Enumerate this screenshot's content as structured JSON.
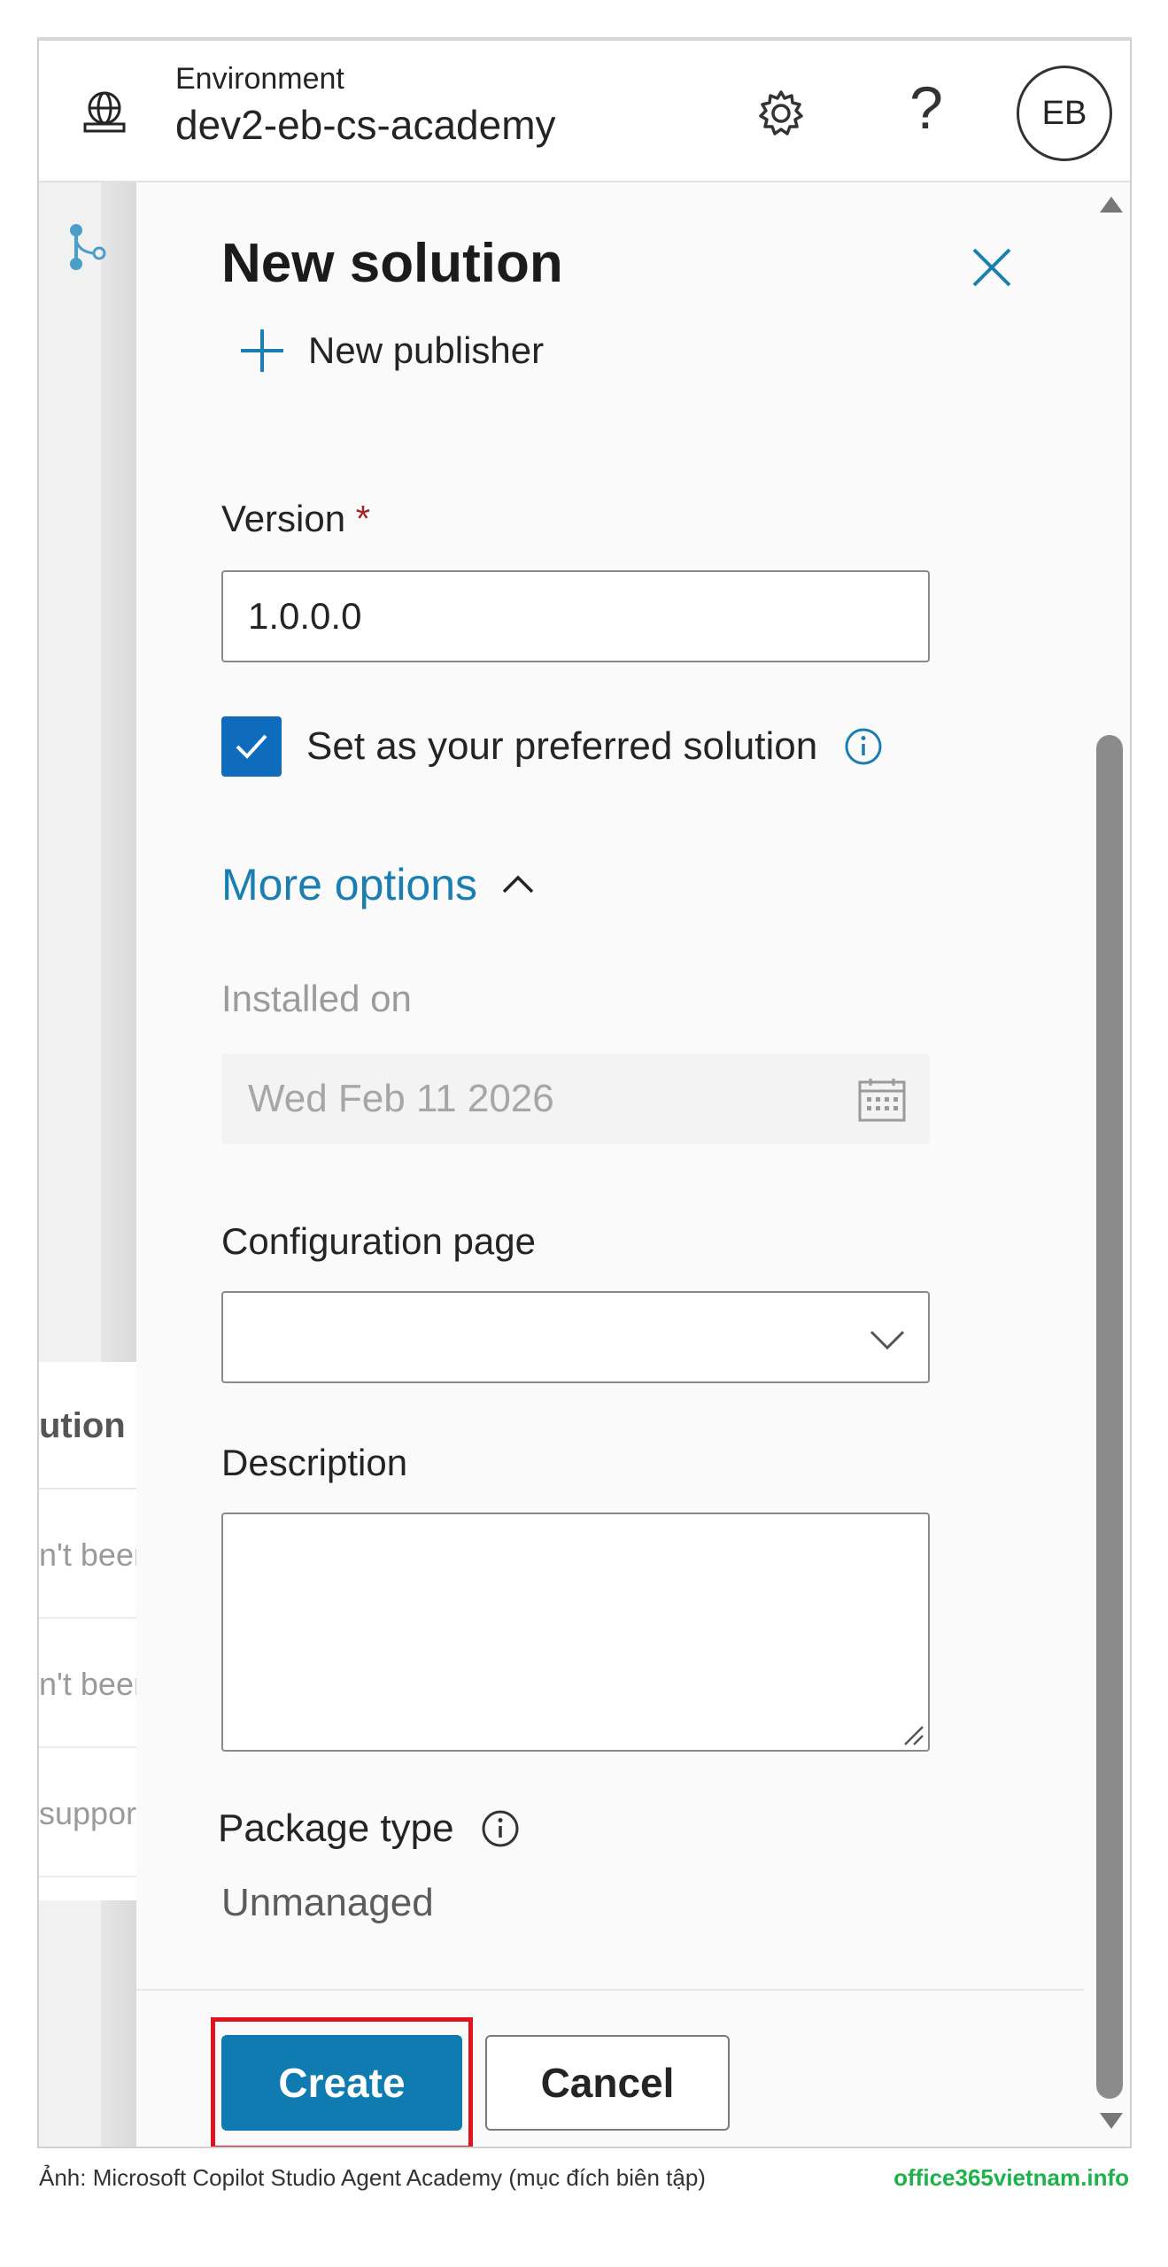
{
  "header": {
    "environment_label": "Environment",
    "environment_name": "dev2-eb-cs-academy",
    "help_glyph": "?",
    "avatar_initials": "EB",
    "icons": [
      "globe-icon",
      "gear-icon",
      "help-icon"
    ]
  },
  "background_table": {
    "header": "ution",
    "rows": [
      "n't been",
      "n't been",
      "suppor"
    ]
  },
  "panel": {
    "title": "New solution",
    "new_publisher_label": "New publisher",
    "version": {
      "label": "Version",
      "required_mark": "*",
      "value": "1.0.0.0"
    },
    "preferred": {
      "label": "Set as your preferred solution",
      "checked": true
    },
    "more_options_label": "More options",
    "installed_on": {
      "label": "Installed on",
      "value": "Wed Feb 11 2026"
    },
    "configuration_page": {
      "label": "Configuration page",
      "value": ""
    },
    "description": {
      "label": "Description",
      "value": ""
    },
    "package_type": {
      "label": "Package type",
      "value": "Unmanaged"
    },
    "buttons": {
      "create": "Create",
      "cancel": "Cancel"
    }
  },
  "footer": {
    "caption": "Ảnh: Microsoft Copilot Studio Agent Academy (mục đích biên tập)",
    "site": "office365vietnam.info"
  },
  "colors": {
    "accent": "#0f7bb0",
    "checkbox": "#0f6cbd",
    "link": "#1a7fb0",
    "highlight": "#e0141e",
    "watermark": "#1fb24a"
  }
}
